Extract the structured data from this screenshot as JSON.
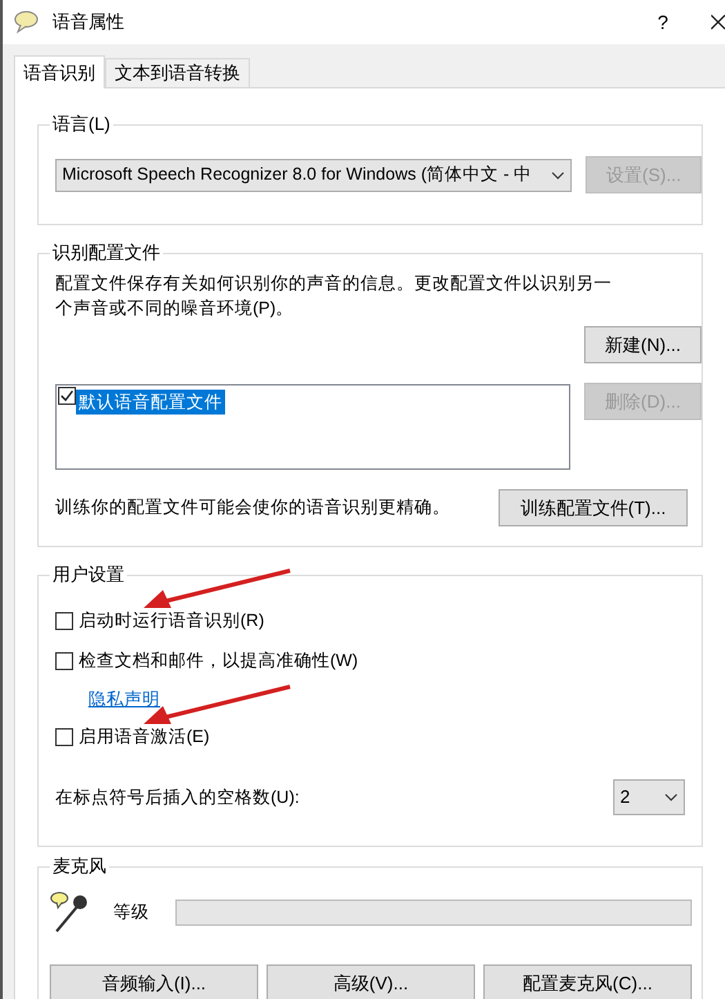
{
  "window": {
    "title": "语音属性",
    "help": "?"
  },
  "tabs": [
    {
      "label": "语音识别",
      "selected": true
    },
    {
      "label": "文本到语音转换",
      "selected": false
    }
  ],
  "language": {
    "legend": "语言(L)",
    "dropdown": "Microsoft Speech Recognizer 8.0 for Windows (简体中文 - 中",
    "settings_button": {
      "label": "设置(S)...",
      "disabled": true
    }
  },
  "profiles": {
    "legend": "识别配置文件",
    "description": "配置文件保存有关如何识别你的声音的信息。更改配置文件以识别另一个声音或不同的噪音环境(P)。",
    "buttons": [
      {
        "label": "新建(N)...",
        "disabled": false
      },
      {
        "label": "删除(D)...",
        "disabled": true
      }
    ],
    "items": [
      {
        "label": "默认语音配置文件",
        "checked": true,
        "selected": true
      }
    ],
    "train_text": "训练你的配置文件可能会使你的语音识别更精确。",
    "train_button": "训练配置文件(T)..."
  },
  "user_settings": {
    "legend": "用户设置",
    "options": [
      {
        "kind": "checkbox",
        "label": "启动时运行语音识别(R)",
        "checked": false,
        "arrow": true
      },
      {
        "kind": "checkbox",
        "label": "检查文档和邮件，以提高准确性(W)",
        "checked": false,
        "arrow": false
      },
      {
        "kind": "link",
        "label": "隐私声明"
      },
      {
        "kind": "checkbox",
        "label": "启用语音激活(E)",
        "checked": false,
        "arrow": true
      }
    ],
    "spaces_label": "在标点符号后插入的空格数(U):",
    "spaces_value": "2"
  },
  "microphone": {
    "legend": "麦克风",
    "level_label": "等级",
    "level": 0,
    "buttons": [
      "音频输入(I)...",
      "高级(V)...",
      "配置麦克风(C)..."
    ]
  }
}
